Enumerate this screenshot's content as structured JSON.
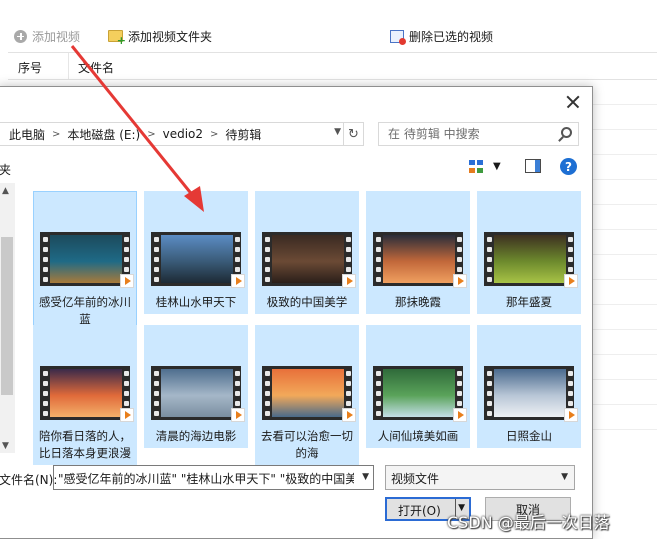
{
  "toolbar": {
    "add_video_label": "添加视频",
    "add_folder_label": "添加视频文件夹",
    "delete_selected_label": "删除已选的视频"
  },
  "list": {
    "col_index": "序号",
    "col_filename": "文件名"
  },
  "dialog": {
    "breadcrumbs": [
      "此电脑",
      "本地磁盘 (E:)",
      "vedio2",
      "待剪辑"
    ],
    "search_placeholder": "在 待剪辑 中搜索",
    "new_folder_partial": "夹",
    "help_label": "?",
    "files": [
      {
        "name": "感受亿年前的冰川蓝",
        "colors": [
          "#1c4a5c",
          "#1f6a86",
          "#a87a3a"
        ]
      },
      {
        "name": "桂林山水甲天下",
        "colors": [
          "#5b8cc4",
          "#3a5b78",
          "#1d2a35"
        ]
      },
      {
        "name": "极致的中国美学",
        "colors": [
          "#3a2a22",
          "#6b4a35",
          "#2a1f1a"
        ]
      },
      {
        "name": "那抹晚霞",
        "colors": [
          "#2a2e3a",
          "#c2683a",
          "#f0a060"
        ]
      },
      {
        "name": "那年盛夏",
        "colors": [
          "#3d3020",
          "#6d8a2d",
          "#a8c346"
        ]
      },
      {
        "name": "陪你看日落的人，比日落本身更浪漫",
        "colors": [
          "#3a2a4a",
          "#e06a3a",
          "#f4b06a"
        ]
      },
      {
        "name": "清晨的海边电影",
        "colors": [
          "#4e6e8e",
          "#a5b7c8",
          "#7a8ea0"
        ]
      },
      {
        "name": "去看可以治愈一切的海",
        "colors": [
          "#e8703a",
          "#f2a95a",
          "#4a6a8a"
        ]
      },
      {
        "name": "人间仙境美如画",
        "colors": [
          "#2f6a3a",
          "#5aa35a",
          "#c4dfe8"
        ]
      },
      {
        "name": "日照金山",
        "colors": [
          "#4a6a8e",
          "#b8c6d6",
          "#eef1f4"
        ]
      }
    ],
    "filename_label": "文件名(N):",
    "filename_value": "\"感受亿年前的冰川蓝\" \"桂林山水甲天下\" \"极致的中国美",
    "filetype_value": "视频文件",
    "open_label": "打开(O)",
    "cancel_label": "取消"
  },
  "watermark": "CSDN @最后一次日落",
  "colors": {
    "tile_selected": "#cce8ff",
    "accent": "#2b6bd4",
    "arrow": "#e53935"
  }
}
